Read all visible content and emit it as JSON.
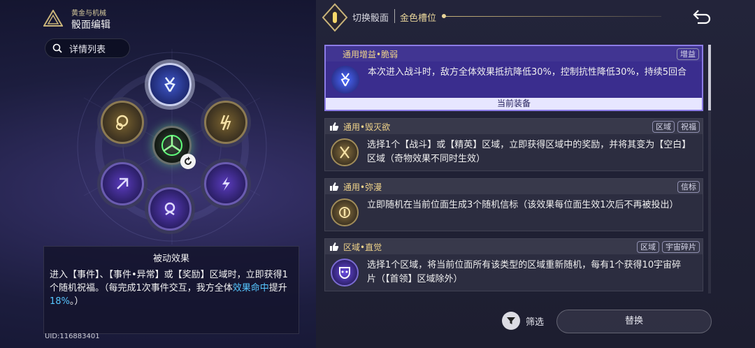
{
  "header": {
    "subtitle": "黄金与机械",
    "title": "骰面编辑"
  },
  "detail_button": {
    "label": "详情列表",
    "icon": "search-icon"
  },
  "wheel": {
    "nodes": [
      {
        "name": "top",
        "icon": "fragility-icon",
        "color": "blue"
      },
      {
        "name": "upper-left",
        "icon": "blessing-icon",
        "color": "gold"
      },
      {
        "name": "upper-right",
        "icon": "lightning-icon",
        "color": "gold"
      },
      {
        "name": "lower-left",
        "icon": "arrow-icon",
        "color": "purple"
      },
      {
        "name": "lower-right",
        "icon": "bolt-icon",
        "color": "purple"
      },
      {
        "name": "bottom",
        "icon": "hand-icon",
        "color": "purple"
      },
      {
        "name": "center",
        "icon": "dice-core-icon",
        "color": "green"
      }
    ]
  },
  "passive": {
    "title": "被动效果",
    "text_a": "进入【事件】、【事件•异常】或【奖励】区域时，立即获得1个随机祝福。（每完成1次事件交互，我方全体",
    "text_hl": "效果命中",
    "text_b": "提升",
    "text_hl2": "18%",
    "text_c": "。）"
  },
  "uid": "UID:116883401",
  "topbar": {
    "switch_label": "切换骰面",
    "slot_label": "金色槽位"
  },
  "cards": [
    {
      "title": "通用增益•脆弱",
      "tags": [
        "增益"
      ],
      "text": "本次进入战斗时，敌方全体效果抵抗降低30%，控制抗性降低30%，持续5回合",
      "equipped": "当前装备",
      "selected": true,
      "thumb": false,
      "icon": "fragility-icon"
    },
    {
      "title": "通用•毁灭欲",
      "tags": [
        "区域",
        "祝福"
      ],
      "text": "选择1个【战斗】或【精英】区域，立即获得区域中的奖励，并将其变为【空白】区域（奇物效果不同时生效）",
      "selected": false,
      "thumb": true,
      "icon": "destruction-icon"
    },
    {
      "title": "通用•弥漫",
      "tags": [
        "信标"
      ],
      "text": "立即随机在当前位面生成3个随机信标（该效果每位面生效1次后不再被投出）",
      "selected": false,
      "thumb": true,
      "icon": "beacon-icon"
    },
    {
      "title": "区域•直觉",
      "tags": [
        "区域",
        "宇宙碎片"
      ],
      "text": "选择1个区域，将当前位面所有该类型的区域重新随机，每有1个获得10宇宙碎片（【首领】区域除外）",
      "selected": false,
      "thumb": true,
      "icon": "mask-icon"
    }
  ],
  "footer": {
    "filter_label": "筛选",
    "replace_label": "替换"
  }
}
